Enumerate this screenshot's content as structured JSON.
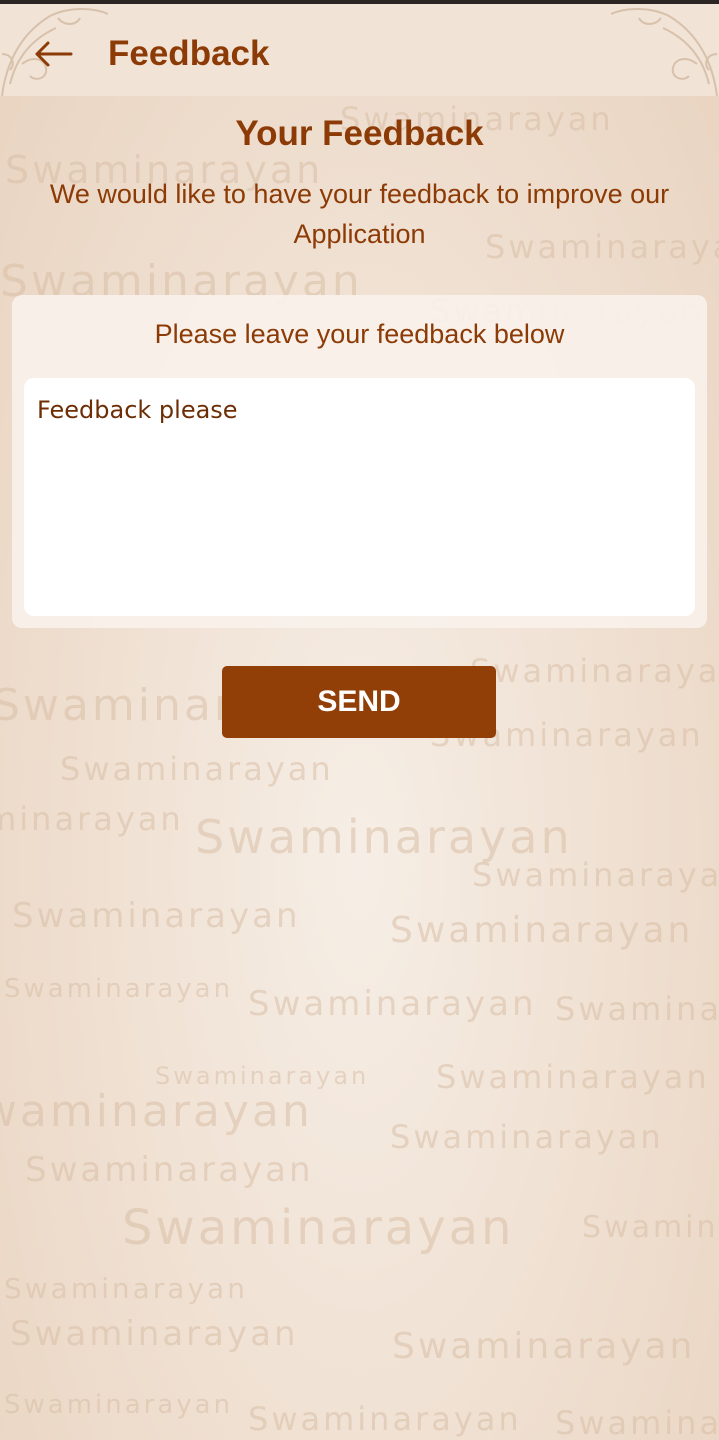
{
  "header": {
    "title": "Feedback",
    "back_icon": "arrow-left-icon"
  },
  "intro": {
    "title": "Your Feedback",
    "subtitle": "We would like to have your feedback to improve our Application"
  },
  "form": {
    "heading": "Please leave your feedback below",
    "feedback_placeholder": "Feedback please",
    "feedback_value": "",
    "send_label": "SEND"
  },
  "background": {
    "watermark_text": "Swaminarayan"
  },
  "colors": {
    "brand_brown": "#8c3b06",
    "button_brown": "#923f07",
    "background_cream": "#efdfd0",
    "card_cream": "#f8f1ea"
  }
}
